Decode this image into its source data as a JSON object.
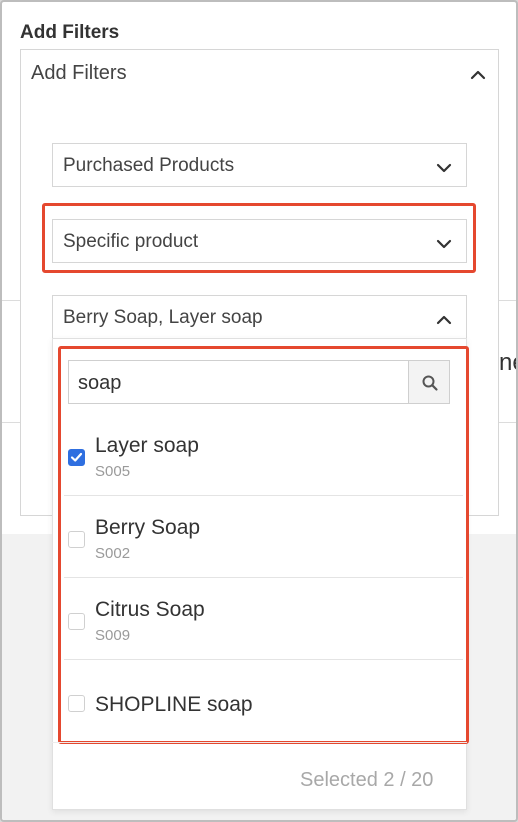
{
  "filters": {
    "title": "Add Filters",
    "main_select_value": "Add Filters",
    "category_select_value": "Purchased Products",
    "mode_select_value": "Specific product",
    "products_select_value": "Berry Soap, Layer soap"
  },
  "search": {
    "value": "soap"
  },
  "products": [
    {
      "name": "Layer soap",
      "code": "S005",
      "checked": true
    },
    {
      "name": "Berry Soap",
      "code": "S002",
      "checked": false
    },
    {
      "name": "Citrus Soap",
      "code": "S009",
      "checked": false
    },
    {
      "name": "SHOPLINE soap",
      "code": "",
      "checked": false
    }
  ],
  "footer": {
    "selected_label": "Selected 2 / 20"
  },
  "background": {
    "cut_text": "ne"
  },
  "colors": {
    "highlight": "#e5482f",
    "checkbox_checked": "#2f6fe0"
  }
}
